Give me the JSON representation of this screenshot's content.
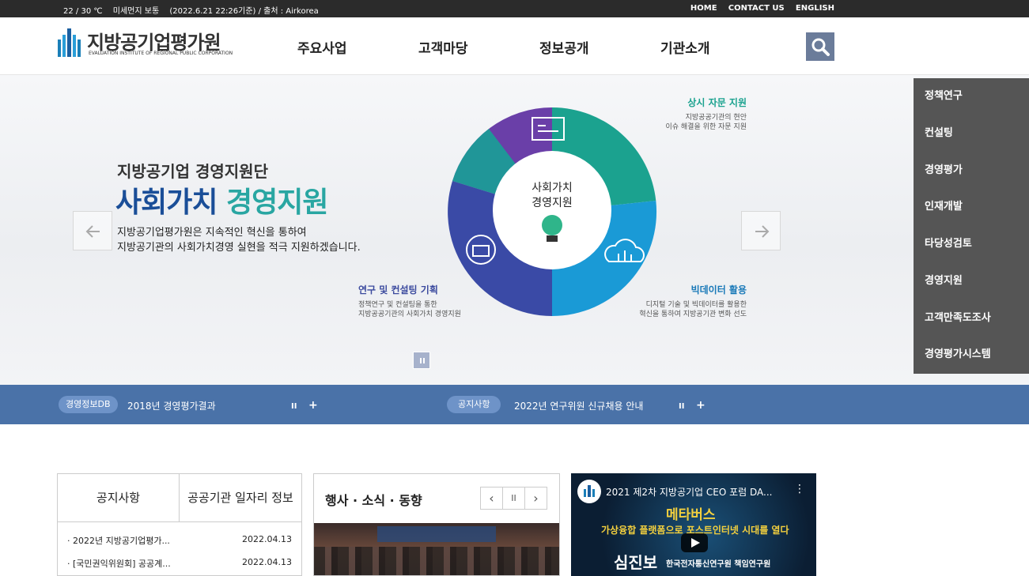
{
  "topbar": {
    "temp": "22 / 30 ℃",
    "dust": "미세먼지 보통",
    "source": "(2022.6.21 22:26기준) / 출처 : Airkorea",
    "links": [
      "HOME",
      "CONTACT US",
      "ENGLISH"
    ]
  },
  "logo": {
    "title": "지방공기업평가원",
    "subtitle": "EVALUATION INSTITUTE OF REGIONAL PUBLIC CORPORATION"
  },
  "gnb": [
    "주요사업",
    "고객마당",
    "정보공개",
    "기관소개"
  ],
  "search_icon": "search-icon",
  "hero": {
    "subtitle": "지방공기업 경영지원단",
    "title_part1": "사회가치",
    "title_part2": "경영지원",
    "desc1": "지방공기업평가원은 지속적인 혁신을 통하여",
    "desc2": "지방공기관의 사회가치경영 실현을 적극 지원하겠습니다.",
    "center1": "사회가치",
    "center2": "경영지원",
    "labels": {
      "tr_title": "상시 자문 지원",
      "tr_desc1": "지방공공기관의 현안",
      "tr_desc2": "이슈 해결을 위한 자문 지원",
      "br_title": "빅데이터 활용",
      "br_desc1": "디지털 기술 및 빅데이터를 활용한",
      "br_desc2": "혁신을 통하여 지방공기관 변화 선도",
      "bl_title": "연구 및 컨설팅 기획",
      "bl_desc1": "정책연구 및 컨설팅을 통한",
      "bl_desc2": "지방공공기관의 사회가치 경영지원"
    },
    "colors": {
      "teal": "#1ba28f",
      "blue": "#1a9ad6",
      "navy": "#3a4aa6",
      "purple": "#6a3fa8"
    }
  },
  "quickmenu": [
    "정책연구",
    "컨설팅",
    "경영평가",
    "인재개발",
    "타당성검토",
    "경영지원",
    "고객만족도조사",
    "경영평가시스템"
  ],
  "noticebar": {
    "badge1": "경영정보DB",
    "text1": "2018년 경영평가결과",
    "badge2": "공지사항",
    "text2": "2022년 연구위원 신규채용 안내",
    "pause": "II",
    "plus": "+"
  },
  "notice_box": {
    "tab1": "공지사항",
    "tab2": "공공기관 일자리 정보",
    "rows": [
      {
        "title": "·  2022년 지방공기업평가...",
        "date": "2022.04.13"
      },
      {
        "title": "·  [국민권익위원회] 공공계...",
        "date": "2022.04.13"
      }
    ]
  },
  "event_box": {
    "title": "행사 · 소식 · 동향",
    "prev": "‹",
    "pause": "II",
    "next": "›"
  },
  "video": {
    "title": "2021 제2차 지방공기업 CEO 포럼 DA...",
    "more": "⋮",
    "line1": "메타버스",
    "line2": "가상융합 플랫폼으로 포스트인터넷 시대를 열다",
    "speaker": "심진보",
    "affiliation": "한국전자통신연구원 책임연구원"
  }
}
